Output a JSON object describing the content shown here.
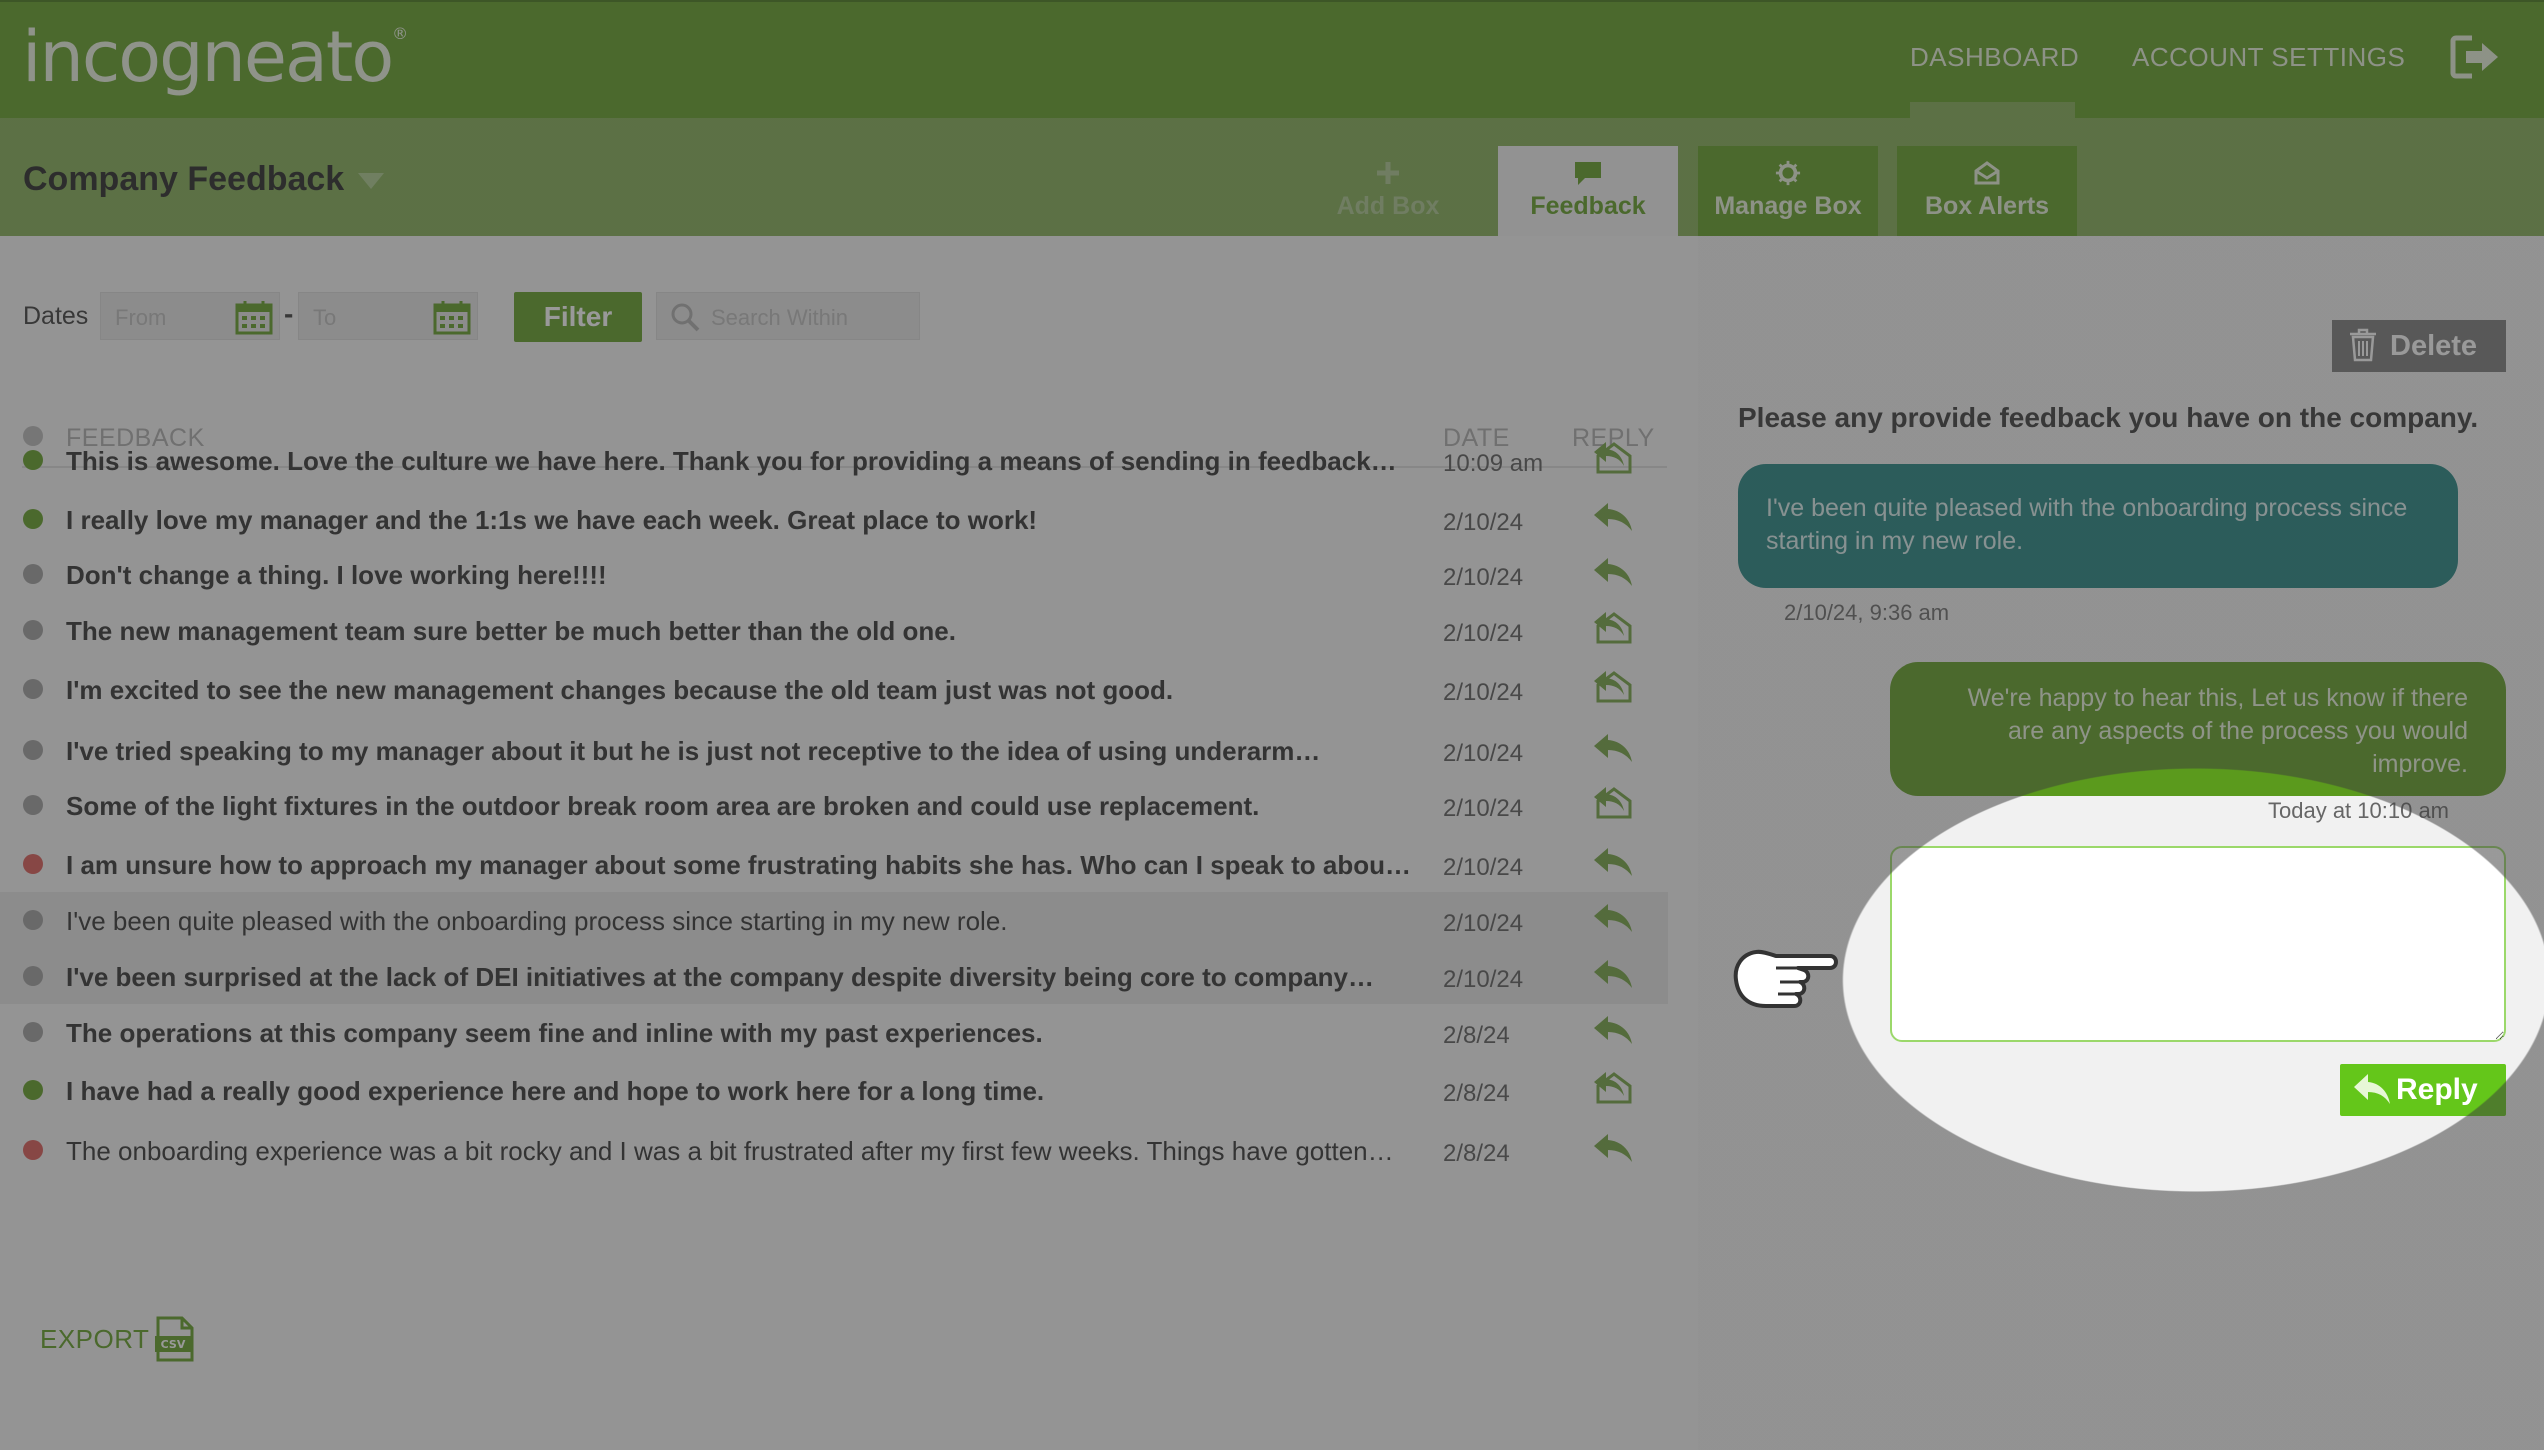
{
  "brand": {
    "logo_text": "incogneato",
    "registered_mark": "®"
  },
  "nav": {
    "dashboard": "DASHBOARD",
    "account_settings": "ACCOUNT SETTINGS",
    "logout_icon": "logout-icon"
  },
  "box": {
    "title": "Company Feedback"
  },
  "tabs": {
    "add_box": "Add Box",
    "feedback": "Feedback",
    "manage_box": "Manage Box",
    "box_alerts": "Box Alerts"
  },
  "filters": {
    "dates_label": "Dates",
    "from_placeholder": "From",
    "to_placeholder": "To",
    "separator": "-",
    "filter_label": "Filter",
    "search_placeholder": "Search Within"
  },
  "table": {
    "headers": {
      "feedback": "FEEDBACK",
      "date": "DATE",
      "reply": "REPLY"
    },
    "rows": [
      {
        "text": "This is awesome. Love the culture we have here. Thank you for providing a means of sending in feedback…",
        "date": "10:09 am",
        "status": "green",
        "bold": true,
        "reply": "envelope"
      },
      {
        "text": "I really love my manager and the 1:1s we have each week. Great place to work!",
        "date": "2/10/24",
        "status": "green",
        "bold": true,
        "reply": "arrow"
      },
      {
        "text": "Don't change a thing. I love working here!!!!",
        "date": "2/10/24",
        "status": "gray",
        "bold": true,
        "reply": "arrow"
      },
      {
        "text": "The new management team sure better be much better than the old one.",
        "date": "2/10/24",
        "status": "gray",
        "bold": true,
        "reply": "envelope"
      },
      {
        "text": "I'm excited to see the new management changes because the old team just was not good.",
        "date": "2/10/24",
        "status": "gray",
        "bold": true,
        "reply": "envelope"
      },
      {
        "text": "I've tried speaking to my manager about it but he is just not receptive to the idea of using underarm…",
        "date": "2/10/24",
        "status": "gray",
        "bold": true,
        "reply": "arrow"
      },
      {
        "text": "Some of the light fixtures in the outdoor break room area are broken and could use replacement.",
        "date": "2/10/24",
        "status": "gray",
        "bold": true,
        "reply": "envelope"
      },
      {
        "text": "I am unsure how to approach my manager about some frustrating habits she has. Who can I speak to about…",
        "date": "2/10/24",
        "status": "red",
        "bold": true,
        "reply": "arrow"
      },
      {
        "text": "I've been quite pleased with the onboarding process since starting in my new role.",
        "date": "2/10/24",
        "status": "gray",
        "bold": false,
        "reply": "arrow",
        "selected": true
      },
      {
        "text": "I've been surprised at the lack of DEI initiatives at the company despite diversity being core to company…",
        "date": "2/10/24",
        "status": "gray",
        "bold": true,
        "reply": "arrow",
        "selected": true
      },
      {
        "text": "The operations at this company seem fine and inline with my past experiences.",
        "date": "2/8/24",
        "status": "gray",
        "bold": true,
        "reply": "arrow"
      },
      {
        "text": "I have had a really good experience here and hope to work here for a long time.",
        "date": "2/8/24",
        "status": "green",
        "bold": true,
        "reply": "envelope"
      },
      {
        "text": "The onboarding experience was a bit rocky and I was a bit frustrated after my first few weeks. Things have gotten…",
        "date": "2/8/24",
        "status": "red",
        "bold": false,
        "reply": "arrow"
      }
    ]
  },
  "export": {
    "label": "EXPORT",
    "icon": "csv-file-icon"
  },
  "detail": {
    "delete_label": "Delete",
    "question": "Please any provide feedback you have on the company.",
    "incoming_message": "I've been quite pleased with the onboarding process since starting in my new role.",
    "incoming_timestamp": "2/10/24, 9:36 am",
    "outgoing_message": "We're happy to hear this, Let us know if there are any aspects of the process you would improve.",
    "outgoing_timestamp": "Today at 10:10 am",
    "reply_value": "",
    "reply_label": "Reply"
  },
  "colors": {
    "brand_green": "#5b9a1d",
    "light_green": "#7eaa4f",
    "teal": "#1a7f7c",
    "bright_green": "#64c61a",
    "status_green": "#5b9a1d",
    "status_gray": "#9a9a9a",
    "status_red": "#d9534f"
  }
}
